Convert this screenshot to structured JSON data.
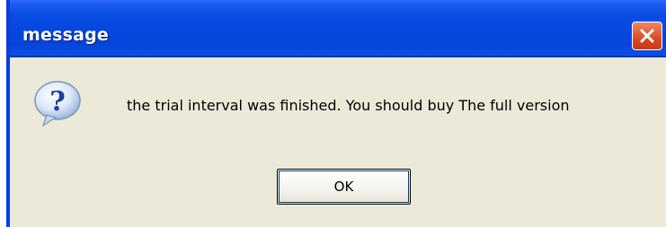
{
  "window": {
    "title": "message",
    "close_icon": "close-icon"
  },
  "body": {
    "icon": "question-icon",
    "message": "the trial interval was finished. You should buy The full version"
  },
  "buttons": {
    "ok_label": "OK"
  },
  "colors": {
    "titlebar": "#0647dd",
    "dialog_background": "#ece9d8",
    "close_button": "#d6431d"
  }
}
